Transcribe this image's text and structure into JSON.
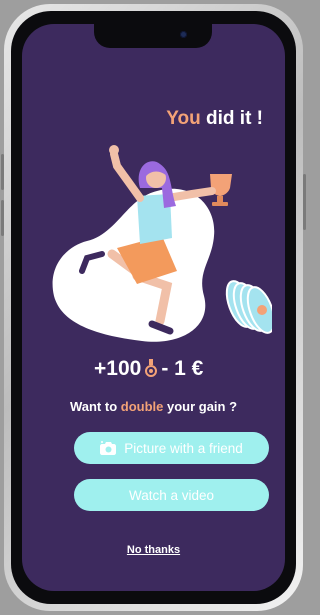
{
  "header": {
    "title_accent": "You",
    "title_rest": "did it !"
  },
  "reward": {
    "points": "+100",
    "cost": "- 1 €",
    "coin_icon": "medal-icon"
  },
  "prompt": {
    "before": "Want to ",
    "highlight": "double",
    "after": " your gain ?"
  },
  "actions": {
    "picture_label": "Picture with a friend",
    "picture_icon": "camera-icon",
    "video_label": "Watch a video",
    "skip_label": "No thanks"
  },
  "colors": {
    "background": "#3d2a5e",
    "accent": "#f3a277",
    "button": "#9ff0ee",
    "text": "#ffffff"
  }
}
